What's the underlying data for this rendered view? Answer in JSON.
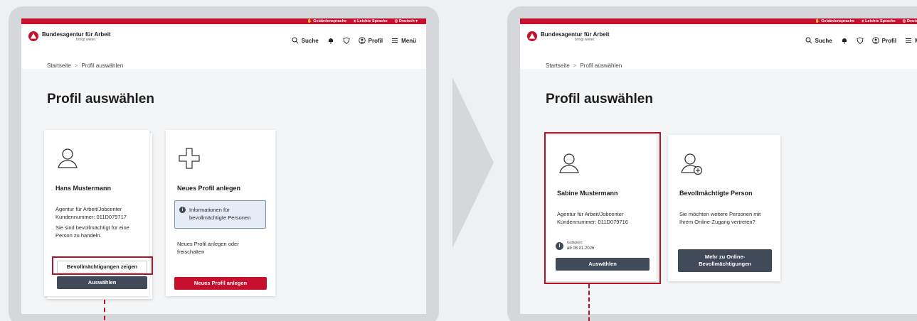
{
  "topbar": {
    "sign_language": "Gebärdensprache",
    "easy_language": "Leichte Sprache",
    "language": "Deutsch"
  },
  "header": {
    "logo_title": "Bundesagentur für Arbeit",
    "logo_tagline": "bringt weiter.",
    "search": "Suche",
    "profile": "Profil",
    "menu": "Menü"
  },
  "breadcrumb": {
    "home": "Startseite",
    "separator": ">",
    "current": "Profil auswählen"
  },
  "page_title": "Profil auswählen",
  "left": {
    "card1": {
      "name": "Hans Mustermann",
      "agency": "Agentur für Arbeit/Jobcenter",
      "customer_number": "Kundennummer: 011D079717",
      "authorization_text": "Sie sind bevollmächtigt für eine Person zu handeln.",
      "show_authorizations_button": "Bevollmächtigungen zeigen",
      "select_button": "Auswählen"
    },
    "card2": {
      "title": "Neues Profil anlegen",
      "info_text": "Informationen für bevollmächtigte Personen",
      "description": "Neues Profil anlegen oder freischalten",
      "button": "Neues Profil anlegen"
    }
  },
  "right": {
    "card1": {
      "name": "Sabine Mustermann",
      "agency": "Agentur für Arbeit/Jobcenter",
      "customer_number": "Kundennummer: 011D079716",
      "validity_label": "Gültigkeit:",
      "validity_value": "ab 08.01.2026",
      "select_button": "Auswählen"
    },
    "card2": {
      "title": "Bevollmächtigte Person",
      "description": "Sie möchten weitere Personen mit Ihrem Online-Zugang vertreten?",
      "button": "Mehr zu Online-Bevollmächtigungen"
    }
  },
  "colors": {
    "brand_red": "#c8102e",
    "button_dark": "#414a58",
    "highlight": "#b3122a",
    "frame": "#d5d7db"
  }
}
